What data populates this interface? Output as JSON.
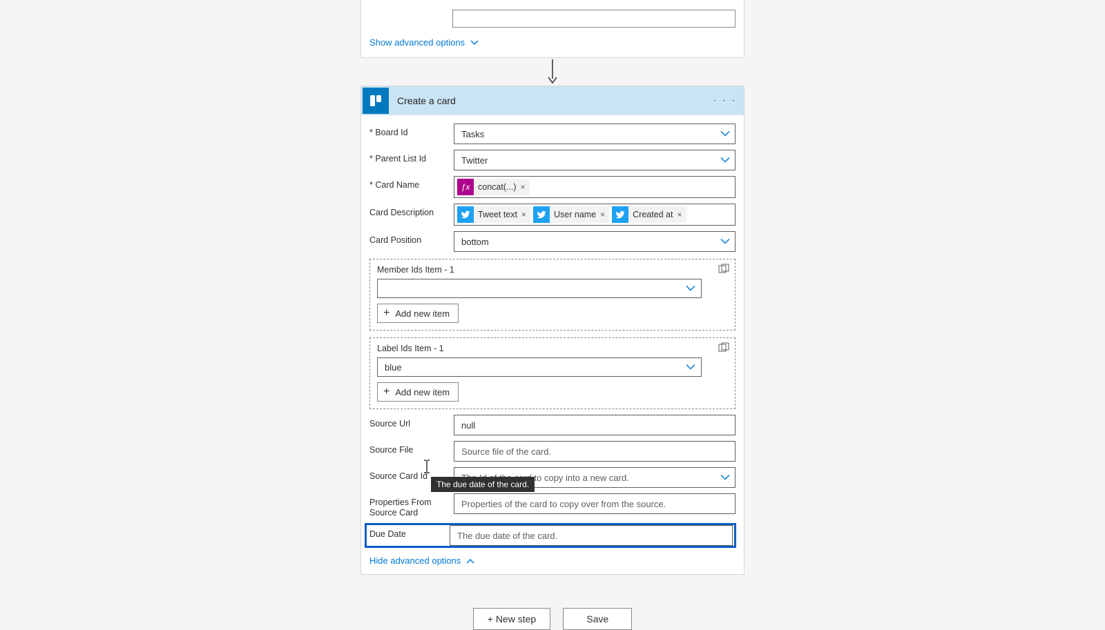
{
  "prev_action": {
    "show_options": "Show advanced options"
  },
  "action": {
    "title": "Create a card",
    "fields": {
      "board_id": {
        "label": "Board Id",
        "value": "Tasks"
      },
      "parent_list": {
        "label": "Parent List Id",
        "value": "Twitter"
      },
      "card_name": {
        "label": "Card Name",
        "token": "concat(...)"
      },
      "card_desc": {
        "label": "Card Description",
        "tokens": [
          "Tweet text",
          "User name",
          "Created at"
        ]
      },
      "card_pos": {
        "label": "Card Position",
        "value": "bottom"
      },
      "member_group": {
        "label": "Member Ids Item - 1",
        "add": "Add new item"
      },
      "label_group": {
        "label": "Label Ids Item - 1",
        "value": "blue",
        "add": "Add new item"
      },
      "source_url": {
        "label": "Source Url",
        "value": "null"
      },
      "source_file": {
        "label": "Source File",
        "placeholder": "Source file of the card."
      },
      "source_card": {
        "label": "Source Card Id",
        "placeholder": "The Id of the card to copy into a new card."
      },
      "props_source": {
        "label": "Properties From Source Card",
        "placeholder": "Properties of the card to copy over from the source."
      },
      "due_date": {
        "label": "Due Date",
        "placeholder": "The due date of the card."
      }
    },
    "hide_options": "Hide advanced options"
  },
  "tooltip": "The due date of the card.",
  "footer": {
    "new_step": "+ New step",
    "save": "Save"
  }
}
